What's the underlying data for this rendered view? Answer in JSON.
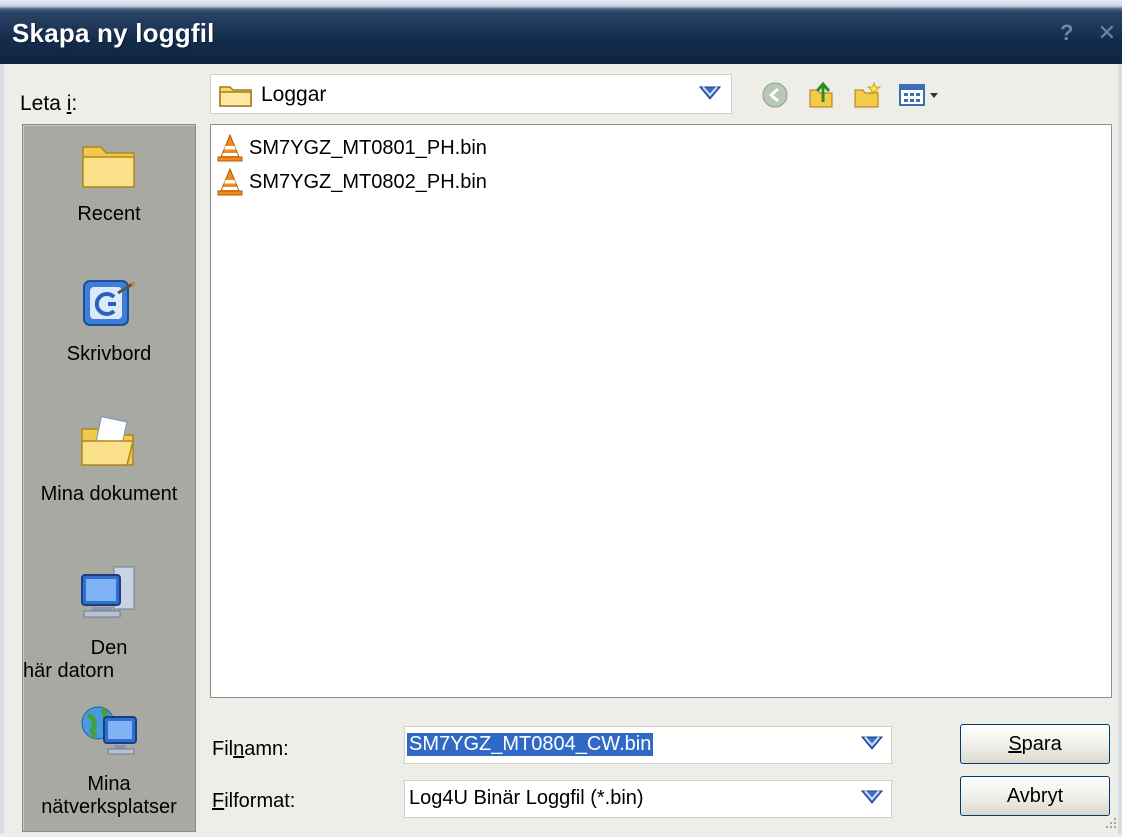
{
  "window": {
    "title": "Skapa ny loggfil",
    "help_glyph": "?",
    "close_glyph": "✕"
  },
  "lookin": {
    "label_pre": "Leta ",
    "label_accel": "i",
    "label_post": ":",
    "current": "Loggar"
  },
  "places": [
    {
      "label": "Recent",
      "icon": "recent-folder-icon"
    },
    {
      "label": "Skrivbord",
      "icon": "desktop-icon"
    },
    {
      "label": "Mina dokument",
      "icon": "my-documents-icon"
    },
    {
      "label_line1": "Den",
      "label_line2": "här datorn",
      "icon": "my-computer-icon"
    },
    {
      "label_line1": "Mina",
      "label_line2": "nätverksplatser",
      "icon": "network-places-icon"
    }
  ],
  "files": [
    {
      "name": "SM7YGZ_MT0801_PH.bin",
      "icon": "vlc-file-icon"
    },
    {
      "name": "SM7YGZ_MT0802_PH.bin",
      "icon": "vlc-file-icon"
    }
  ],
  "filename": {
    "label_pre": "Fil",
    "label_accel": "n",
    "label_post": "amn:",
    "value": "SM7YGZ_MT0804_CW.bin"
  },
  "filetype": {
    "label_accel": "F",
    "label_post": "ilformat:",
    "value": "Log4U Binär Loggfil (*.bin)"
  },
  "buttons": {
    "save_accel": "S",
    "save_rest": "para",
    "cancel": "Avbryt"
  },
  "colors": {
    "titlebar": "#142c4c",
    "selection": "#316ac5",
    "places_bg": "#a9a9a4"
  }
}
